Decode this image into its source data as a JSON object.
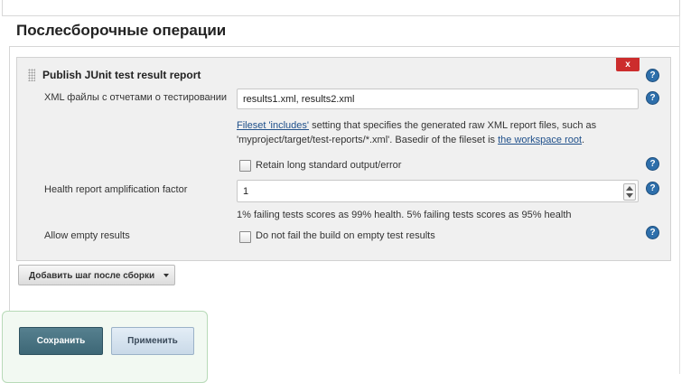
{
  "section": {
    "title": "Послесборочные операции"
  },
  "step": {
    "title": "Publish JUnit test result report",
    "delete_label": "x",
    "help_label": "?",
    "xml_files": {
      "label": "XML файлы с отчетами о тестировании",
      "value": "results1.xml, results2.xml",
      "desc_link1": "Fileset 'includes'",
      "desc_text1": " setting that specifies the generated raw XML report files, such as",
      "desc_text2": "'myproject/target/test-reports/*.xml'. Basedir of the fileset is ",
      "desc_link2": "the workspace root",
      "desc_end": "."
    },
    "retain_output": {
      "label": "Retain long standard output/error",
      "checked": false
    },
    "health_factor": {
      "label": "Health report amplification factor",
      "value": "1",
      "desc": "1% failing tests scores as 99% health. 5% failing tests scores as 95% health"
    },
    "allow_empty": {
      "label": "Allow empty results",
      "checkbox_label": "Do not fail the build on empty test results",
      "checked": false
    }
  },
  "add_step_button": {
    "label": "Добавить шаг после сборки"
  },
  "footer": {
    "save_label": "Сохранить",
    "apply_label": "Применить"
  },
  "colors": {
    "save": "#446d7c",
    "apply": "#d4e2ee",
    "delete": "#cc2d2d",
    "help": "#2e6fab"
  }
}
